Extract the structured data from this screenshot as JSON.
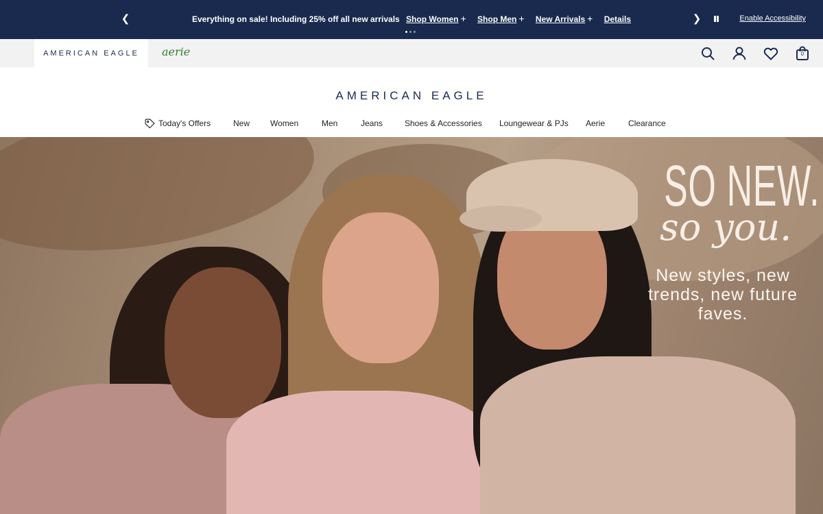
{
  "promo": {
    "message": "Everything on sale! Including 25% off all new arrivals",
    "links": [
      "Shop Women",
      "Shop Men",
      "New Arrivals"
    ],
    "details": "Details",
    "accessibility": "Enable Accessibility",
    "prev_icon": "chevron-left-icon",
    "next_icon": "chevron-right-icon",
    "pause_icon": "pause-icon",
    "slide_count": 3,
    "active_slide": 1
  },
  "brand_bar": {
    "ae_label": "AMERICAN EAGLE",
    "aerie_label": "aerie",
    "icons": [
      "search-icon",
      "user-icon",
      "heart-icon",
      "bag-icon"
    ],
    "bag_count": "0"
  },
  "logo": "AMERICAN EAGLE",
  "nav": {
    "items": [
      "Today's Offers",
      "New",
      "Women",
      "Men",
      "Jeans",
      "Shoes & Accessories",
      "Loungewear & PJs",
      "Aerie",
      "Clearance"
    ]
  },
  "hero": {
    "headline": "SO NEW.",
    "script": "so you.",
    "subtext": "New styles, new trends, new future faves."
  },
  "colors": {
    "navy": "#1a2a4e",
    "aerie_green": "#2e7d32",
    "brand_bar_bg": "#f2f2f2",
    "hero_text": "#f8eee6"
  }
}
